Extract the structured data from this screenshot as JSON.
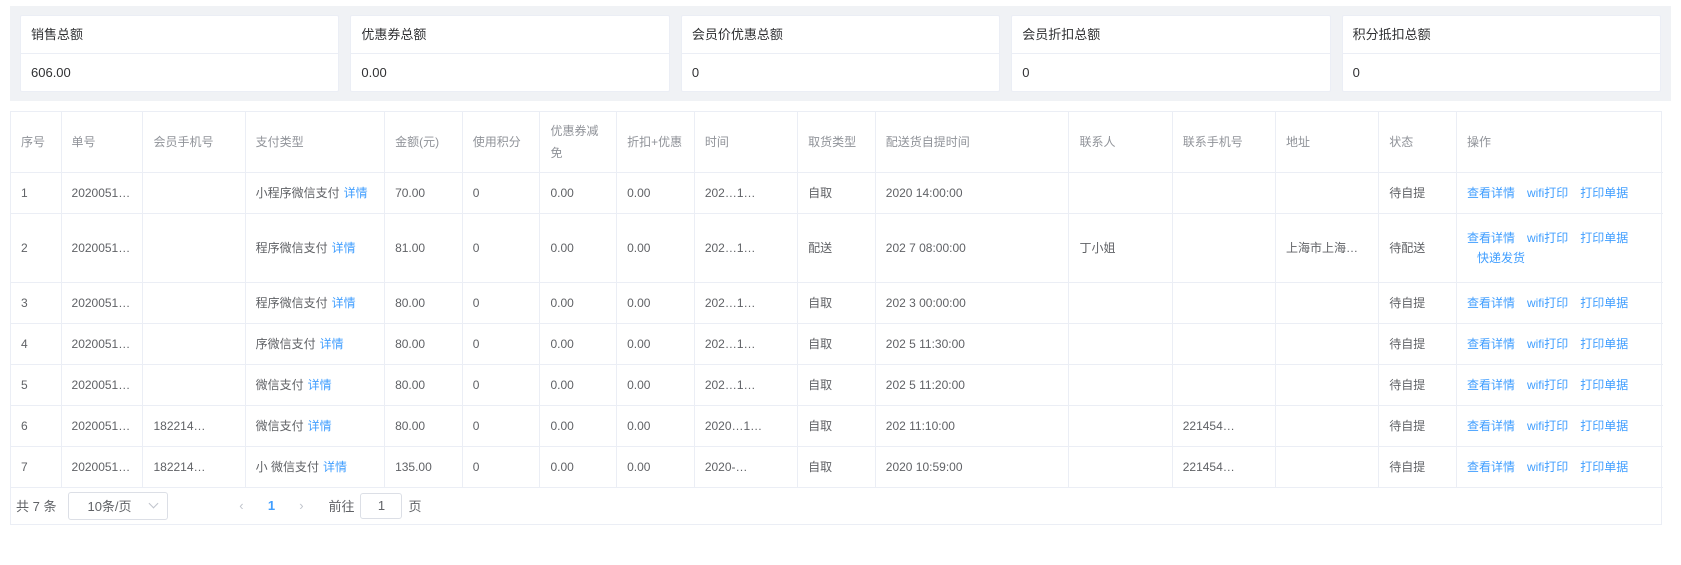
{
  "summary": [
    {
      "title": "销售总额",
      "value": "606.00"
    },
    {
      "title": "优惠券总额",
      "value": "0.00"
    },
    {
      "title": "会员价优惠总额",
      "value": "0"
    },
    {
      "title": "会员折扣总额",
      "value": "0"
    },
    {
      "title": "积分抵扣总额",
      "value": "0"
    }
  ],
  "table": {
    "headers": [
      "序号",
      "单号",
      "会员手机号",
      "支付类型",
      "金额(元)",
      "使用积分",
      "优惠券减免",
      "折扣+优惠",
      "时间",
      "取货类型",
      "配送货自提时间",
      "联系人",
      "联系手机号",
      "地址",
      "状态",
      "操作"
    ],
    "detail_link": "详情",
    "actions": {
      "view": "查看详情",
      "wifi": "wifi打印",
      "print": "打印单据",
      "ship": "快递发货"
    },
    "rows": [
      {
        "no": "1",
        "order": "2020051…",
        "phone": "",
        "pay": "小程序微信支付",
        "amount": "70.00",
        "points": "0",
        "coupon": "0.00",
        "discount": "0.00",
        "time": "202…1…",
        "pickup": "自取",
        "delivery_time": "2020 14:00:00",
        "contact": "",
        "contact_phone": "",
        "address": "",
        "status": "待自提"
      },
      {
        "no": "2",
        "order": "2020051…",
        "phone": "",
        "pay": "程序微信支付",
        "amount": "81.00",
        "points": "0",
        "coupon": "0.00",
        "discount": "0.00",
        "time": "202…1…",
        "pickup": "配送",
        "delivery_time": "202 7 08:00:00",
        "contact": "丁小姐",
        "contact_phone": "",
        "address": "上海市上海…",
        "status": "待配送"
      },
      {
        "no": "3",
        "order": "2020051…",
        "phone": "",
        "pay": "程序微信支付",
        "amount": "80.00",
        "points": "0",
        "coupon": "0.00",
        "discount": "0.00",
        "time": "202…1…",
        "pickup": "自取",
        "delivery_time": "202 3 00:00:00",
        "contact": "",
        "contact_phone": "",
        "address": "",
        "status": "待自提"
      },
      {
        "no": "4",
        "order": "2020051…",
        "phone": "",
        "pay": "序微信支付",
        "amount": "80.00",
        "points": "0",
        "coupon": "0.00",
        "discount": "0.00",
        "time": "202…1…",
        "pickup": "自取",
        "delivery_time": "202 5 11:30:00",
        "contact": "",
        "contact_phone": "",
        "address": "",
        "status": "待自提"
      },
      {
        "no": "5",
        "order": "2020051…",
        "phone": "",
        "pay": "微信支付",
        "amount": "80.00",
        "points": "0",
        "coupon": "0.00",
        "discount": "0.00",
        "time": "202…1…",
        "pickup": "自取",
        "delivery_time": "202 5 11:20:00",
        "contact": "",
        "contact_phone": "",
        "address": "",
        "status": "待自提"
      },
      {
        "no": "6",
        "order": "2020051…",
        "phone": "182214…",
        "pay": "微信支付",
        "amount": "80.00",
        "points": "0",
        "coupon": "0.00",
        "discount": "0.00",
        "time": "2020…1…",
        "pickup": "自取",
        "delivery_time": "202 11:10:00",
        "contact": "",
        "contact_phone": "221454…",
        "address": "",
        "status": "待自提"
      },
      {
        "no": "7",
        "order": "2020051…",
        "phone": "182214…",
        "pay": "小 微信支付",
        "amount": "135.00",
        "points": "0",
        "coupon": "0.00",
        "discount": "0.00",
        "time": "2020-…",
        "pickup": "自取",
        "delivery_time": "2020 10:59:00",
        "contact": "",
        "contact_phone": "221454…",
        "address": "",
        "status": "待自提"
      }
    ]
  },
  "pager": {
    "total": "共 7 条",
    "page_size": "10条/页",
    "current": "1",
    "goto_label": "前往",
    "goto_value": "1",
    "page_suffix": "页"
  }
}
